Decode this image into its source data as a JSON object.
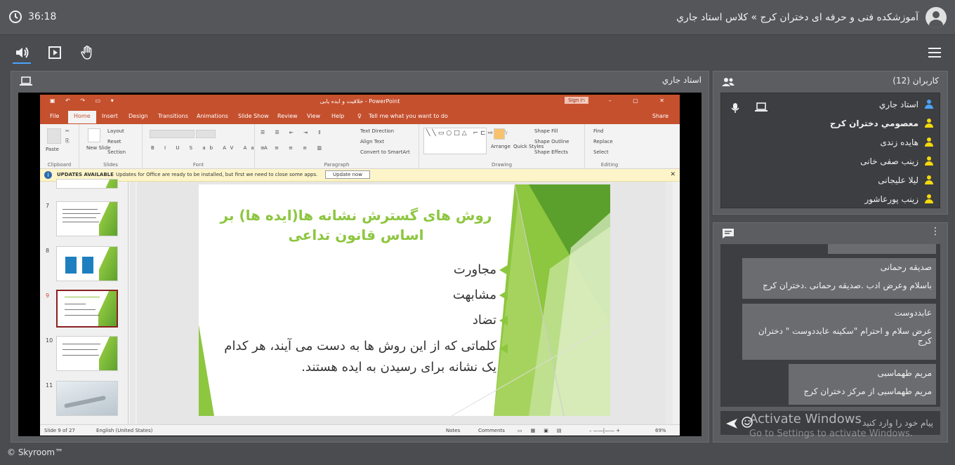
{
  "header": {
    "timer": "36:18",
    "breadcrumb": "آموزشکده فنی و حرفه ای دختران کرج » کلاس استاد جاري"
  },
  "main": {
    "presenter_label": "استاد جاري"
  },
  "ppt": {
    "file_title": "خلاقیت و ایده یابی - PowerPoint",
    "sign_in": "Sign in",
    "share": "Share",
    "tabs": [
      "File",
      "Home",
      "Insert",
      "Design",
      "Transitions",
      "Animations",
      "Slide Show",
      "Review",
      "View",
      "Help",
      "Tell me what you want to do"
    ],
    "ribbon": {
      "paste": "Paste",
      "clipboard": "Clipboard",
      "layout": "Layout",
      "reset": "Reset",
      "new_slide": "New Slide",
      "section": "Section",
      "slides": "Slides",
      "font": "Font",
      "paragraph": "Paragraph",
      "text_direction": "Text Direction",
      "align_text": "Align Text",
      "convert_smartart": "Convert to SmartArt",
      "arrange": "Arrange",
      "quick_styles": "Quick Styles",
      "shape_fill": "Shape Fill",
      "shape_outline": "Shape Outline",
      "shape_effects": "Shape Effects",
      "drawing": "Drawing",
      "find": "Find",
      "replace": "Replace",
      "select": "Select",
      "editing": "Editing"
    },
    "updates": {
      "title": "UPDATES AVAILABLE",
      "message": "Updates for Office are ready to be installed, but first we need to close some apps.",
      "button": "Update now"
    },
    "thumb_numbers": [
      "7",
      "8",
      "9",
      "10",
      "11"
    ],
    "slide": {
      "title": "روش های گسترش نشانه ها(ایده ها) بر اساس قانون تداعی",
      "bullets": [
        "مجاورت",
        "مشابهت",
        "تضاد",
        "کلماتی که از این روش ها به دست می آیند، هر کدام یک نشانه برای رسیدن به ایده هستند."
      ]
    },
    "status": {
      "slide_count": "Slide 9 of 27",
      "language": "English (United States)",
      "notes": "Notes",
      "comments": "Comments",
      "zoom": "69%"
    }
  },
  "users": {
    "title": "کاربران (12)",
    "list": [
      {
        "name": "استاد جاري",
        "color": "#4aa3ff",
        "bold": false
      },
      {
        "name": "معصومي دختران کرج",
        "color": "#f5d90a",
        "bold": true
      },
      {
        "name": "هایده زندی",
        "color": "#f5d90a",
        "bold": false
      },
      {
        "name": "زینب صفی خانی",
        "color": "#f5d90a",
        "bold": false
      },
      {
        "name": "لیلا علیجانی",
        "color": "#f5d90a",
        "bold": false
      },
      {
        "name": "زینب پورعاشور",
        "color": "#f5d90a",
        "bold": false
      }
    ]
  },
  "chat": {
    "messages": [
      {
        "name": "صدیقه رحمانی",
        "text": "باسلام وعرض ادب .صدیقه رحمانی .دختران کرج"
      },
      {
        "name": "عابددوست",
        "text": "عرض سلام و احترام \"سکینه عابددوست \" دختران کرج"
      },
      {
        "name": "مریم طهماسبی",
        "text": "مریم طهماسبی از مرکز دختران کرج"
      }
    ],
    "placeholder": "پیام خود را وارد کنید"
  },
  "watermark": {
    "line1": "Activate Windows",
    "line2": "Go to Settings to activate Windows."
  },
  "footer": "© Skyroom™"
}
